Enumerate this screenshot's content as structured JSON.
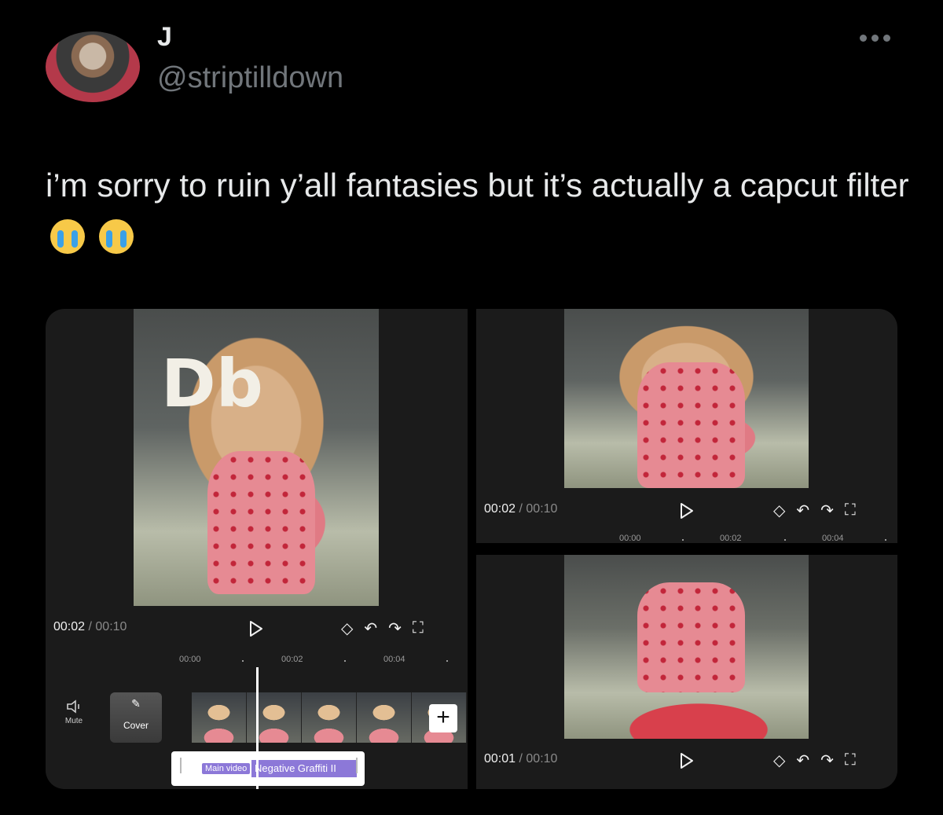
{
  "tweet": {
    "display_name": "J",
    "handle": "@striptilldown",
    "text": "i’m sorry to ruin y’all fantasies but it’s actually a capcut filter",
    "emoji": [
      "crying-face",
      "crying-face"
    ]
  },
  "editor_left": {
    "current_time": "00:02",
    "separator": "/",
    "total_time": "00:10",
    "ruler_marks": [
      "00:00",
      "00:02",
      "00:04"
    ],
    "mute_label": "Mute",
    "cover_label": "Cover",
    "add_label": "+",
    "main_video_chip": "Main video",
    "effect_label": "Negative Graffiti II",
    "graffiti_text": "Db"
  },
  "editor_top_right": {
    "current_time": "00:02",
    "separator": "/",
    "total_time": "00:10",
    "ruler_marks": [
      "00:00",
      "00:02",
      "00:04"
    ]
  },
  "editor_bottom_right": {
    "current_time": "00:01",
    "separator": "/",
    "total_time": "00:10"
  }
}
